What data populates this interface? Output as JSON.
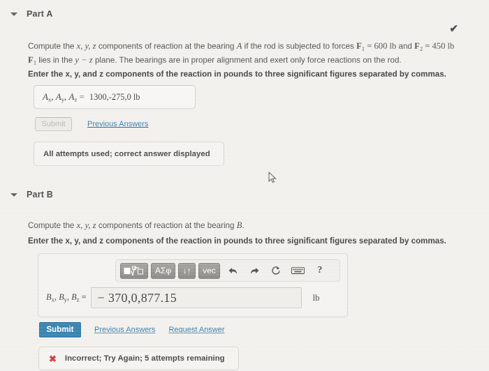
{
  "part_a": {
    "caret_icon": "caret-down-icon",
    "title": "Part A",
    "status_check_icon": "check-icon",
    "question_line1_pre": "Compute the ",
    "question_line1_vars": "x, y, z",
    "question_line1_mid": " components of reaction at the bearing ",
    "question_line1_bearing": "A",
    "question_line1_post": " if the rod is subjected to forces ",
    "force1": "F",
    "force1_sub": "1",
    "force1_val": " = 600 lb",
    "and": " and ",
    "force2": "F",
    "force2_sub": "2",
    "force2_val": " = 450 lb",
    "question_line2_pre": "",
    "line2_force": "F",
    "line2_force_sub": "1",
    "line2_text_a": " lies in the ",
    "line2_plane": "y − z",
    "line2_text_b": " plane. The bearings are in proper alignment and exert only force reactions on the rod.",
    "instruction": "Enter the x, y, and z components of the reaction in pounds to three significant figures separated by commas.",
    "answer_label_ax": "A",
    "answer_label_ax_sub": "x",
    "answer_label_ay": "A",
    "answer_label_ay_sub": "y",
    "answer_label_az": "A",
    "answer_label_az_sub": "z",
    "answer_equals": "=",
    "answer_value": "1300,-275,0  lb",
    "submit_label": "Submit",
    "previous_answers_label": "Previous Answers",
    "status_message": "All attempts used; correct answer displayed"
  },
  "part_b": {
    "caret_icon": "caret-down-icon",
    "title": "Part B",
    "question_pre": "Compute the ",
    "question_vars": "x, y, z",
    "question_mid": " components of reaction at the bearing ",
    "question_bearing": "B",
    "question_post": ".",
    "instruction": "Enter the x, y, and z components of the reaction in pounds to three significant figures separated by commas.",
    "toolbar": {
      "template_button": "▢√▢",
      "symbols_button": "ΑΣφ",
      "updown_button": "↓↑",
      "vector_button": "vec",
      "undo_icon": "undo-arrow-icon",
      "redo_icon": "redo-arrow-icon",
      "reset_icon": "reset-circle-icon",
      "keyboard_icon": "keyboard-icon",
      "help_label": "?"
    },
    "answer_label_bx": "B",
    "answer_label_bx_sub": "x",
    "answer_label_by": "B",
    "answer_label_by_sub": "y",
    "answer_label_bz": "B",
    "answer_label_bz_sub": "z",
    "answer_equals": "=",
    "answer_value": "− 370,0,877.15",
    "unit": "lb",
    "submit_label": "Submit",
    "previous_answers_label": "Previous Answers",
    "request_answer_label": "Request Answer",
    "incorrect_icon": "x-mark-icon",
    "incorrect_message": "Incorrect; Try Again; 5 attempts remaining"
  },
  "cursor": {
    "icon": "mouse-pointer-icon"
  },
  "colors": {
    "page_background": "#f2f0ec",
    "submit_blue": "#1b73a6",
    "link_blue": "#1c6ea4",
    "incorrect_red": "#cc1f2e",
    "toolbar_button": "#8a8883"
  }
}
